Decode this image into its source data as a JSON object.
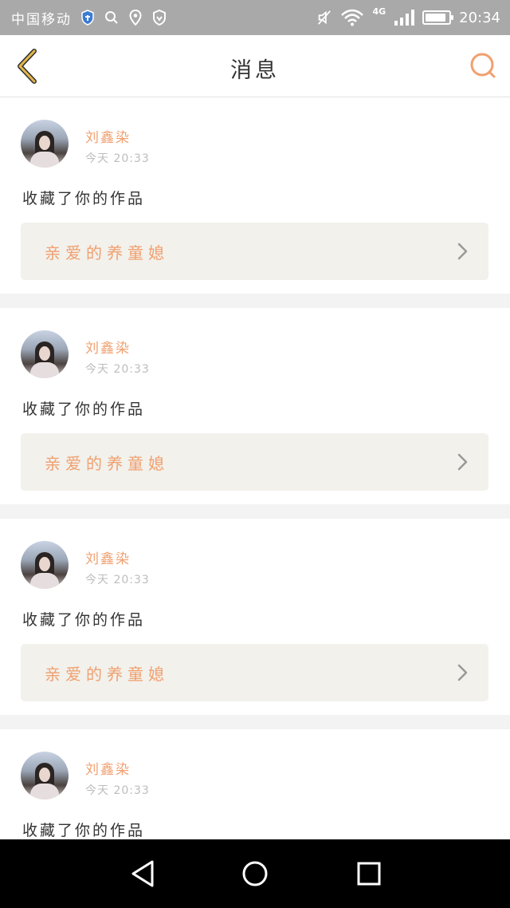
{
  "status_bar": {
    "carrier": "中国移动",
    "network": "4G",
    "time": "20:34",
    "battery_level": 0.9,
    "icons": [
      "shield-icon",
      "search-icon",
      "location-pin-icon",
      "heart-shield-icon",
      "mute-icon",
      "wifi-icon",
      "signal-icon",
      "battery-icon"
    ]
  },
  "header": {
    "title": "消息",
    "back_icon": "chevron-left-icon",
    "search_icon": "search-icon"
  },
  "messages": [
    {
      "user": "刘鑫染",
      "time": "今天 20:33",
      "action": "收藏了你的作品",
      "work_title": "亲爱的养童媳"
    },
    {
      "user": "刘鑫染",
      "time": "今天 20:33",
      "action": "收藏了你的作品",
      "work_title": "亲爱的养童媳"
    },
    {
      "user": "刘鑫染",
      "time": "今天 20:33",
      "action": "收藏了你的作品",
      "work_title": "亲爱的养童媳"
    },
    {
      "user": "刘鑫染",
      "time": "今天 20:33",
      "action": "收藏了你的作品",
      "work_title": ""
    }
  ],
  "nav_bar": {
    "buttons": [
      "back-triangle-icon",
      "home-circle-icon",
      "recents-square-icon"
    ]
  },
  "colors": {
    "accent": "#f0a070",
    "back_arrow": "#e2b84a",
    "status_bar": "#a9a9a9"
  }
}
